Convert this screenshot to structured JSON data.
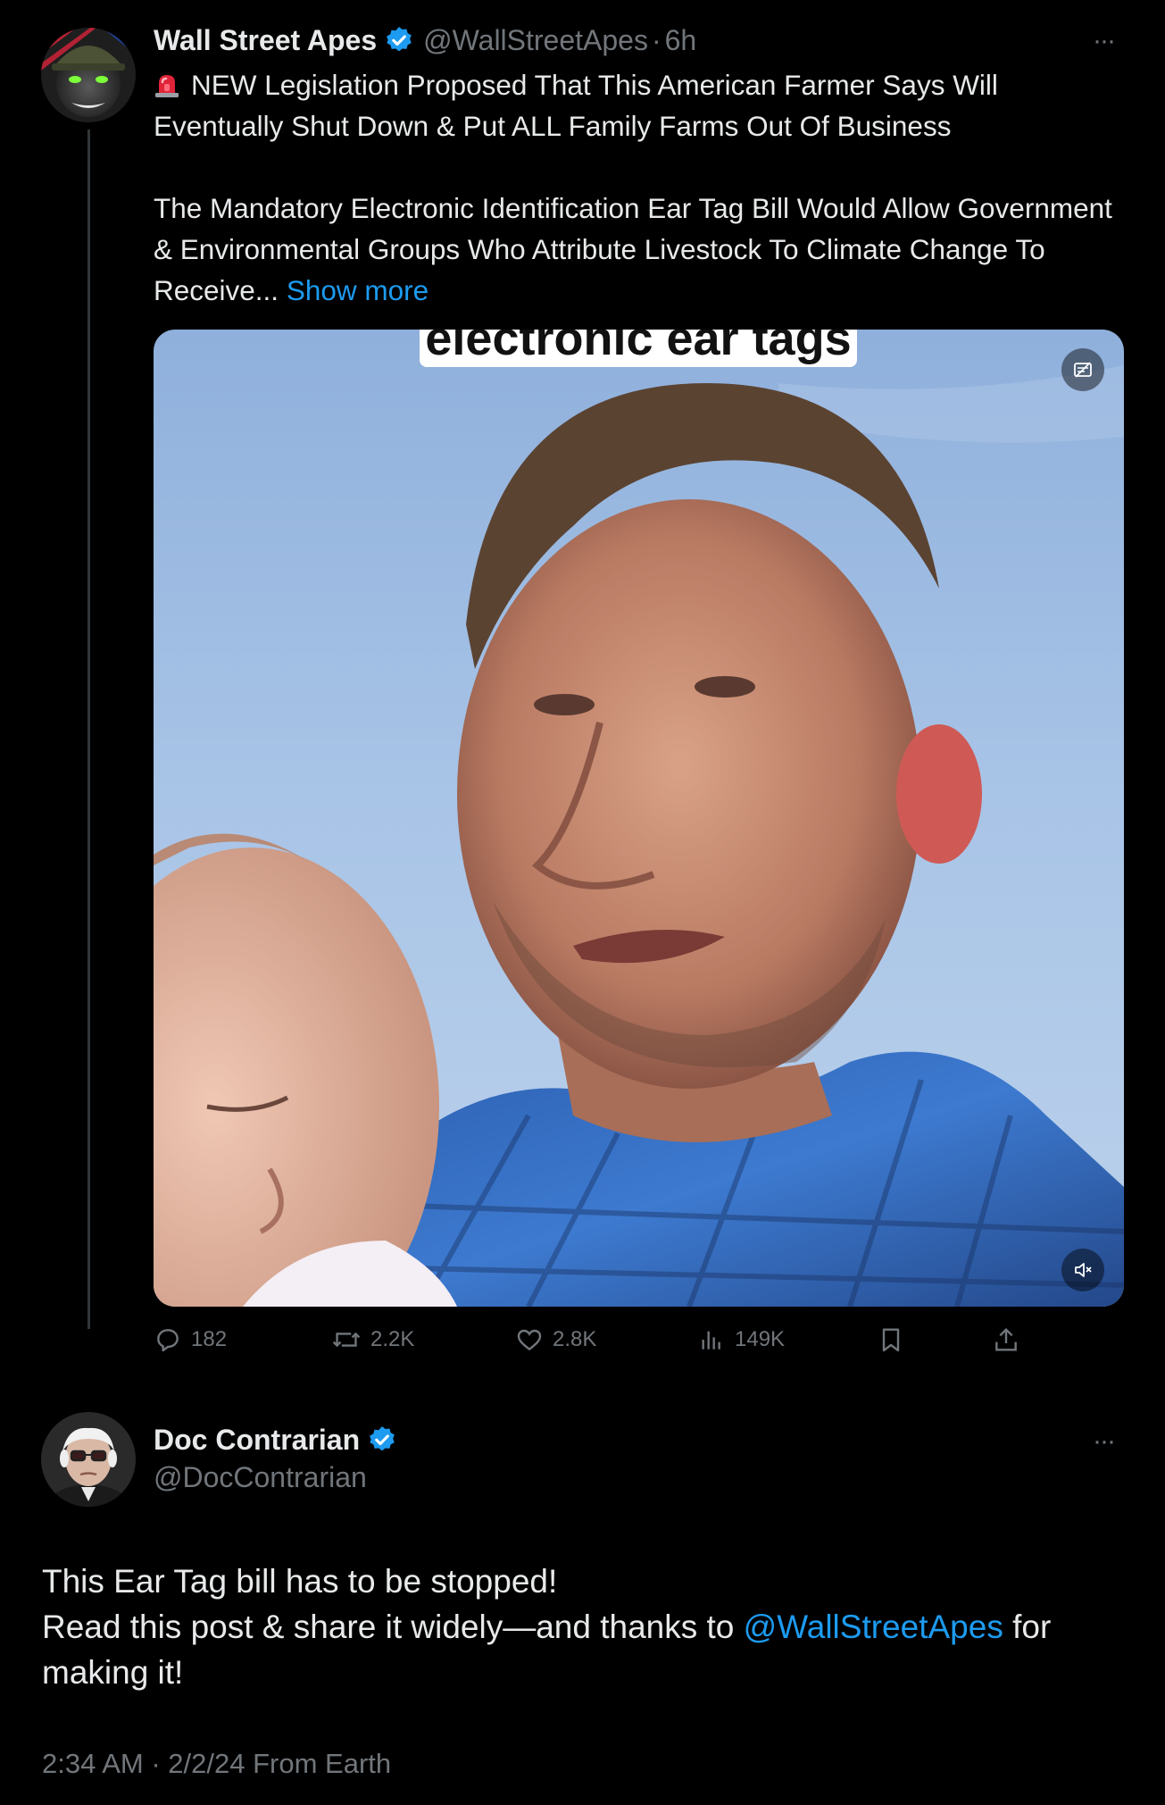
{
  "colors": {
    "background": "#000000",
    "text_primary": "#e7e9ea",
    "text_secondary": "#71767b",
    "accent": "#1d9bf0",
    "thread_line": "#333639"
  },
  "original_post": {
    "author_name": "Wall Street Apes",
    "verified": true,
    "handle": "@WallStreetApes",
    "separator": "·",
    "time_ago": "6h",
    "more_menu": "···",
    "avatar_icon": "helmeted-gorilla-avatar",
    "siren_icon": "police-siren-emoji",
    "text_line1": "NEW Legislation Proposed That This American Farmer Says Will Eventually Shut Down & Put ALL Family Farms Out Of Business",
    "text_line2": "The Mandatory Electronic Identification Ear Tag Bill Would Allow Government & Environmental Groups Who Attribute Livestock To Climate Change To Receive...",
    "show_more": "Show more",
    "media": {
      "caption": "electronic ear tags",
      "top_right_icon": "content-filter-icon",
      "mute_icon": "volume-muted-icon"
    },
    "actions": {
      "replies": "182",
      "reposts": "2.2K",
      "likes": "2.8K",
      "views": "149K",
      "bookmark_icon": "bookmark-icon",
      "share_icon": "share-icon"
    }
  },
  "reply_post": {
    "author_name": "Doc Contrarian",
    "verified": true,
    "handle": "@DocContrarian",
    "more_menu": "···",
    "avatar_icon": "elderly-man-portrait-avatar",
    "text_line1": "This Ear Tag bill has to be stopped!",
    "text_line2_before": "Read this post & share it widely—and thanks to ",
    "mention": "@WallStreetApes",
    "text_line2_after": " for making it!",
    "timestamp": "2:34 AM · 2/2/24 From Earth"
  }
}
